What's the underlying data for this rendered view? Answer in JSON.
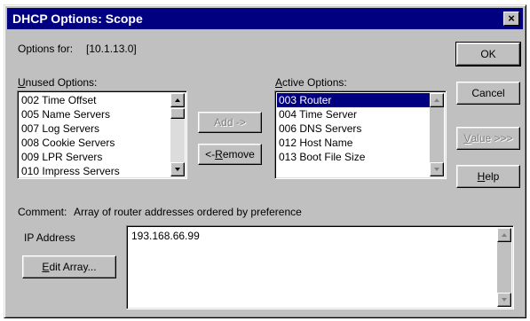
{
  "window": {
    "title": "DHCP Options: Scope",
    "close_glyph": "×"
  },
  "options_for": {
    "label": "Options for:",
    "value": "[10.1.13.0]"
  },
  "unused": {
    "label_key": "U",
    "label_rest": "nused Options:",
    "items": [
      "002 Time Offset",
      "005 Name Servers",
      "007 Log Servers",
      "008 Cookie Servers",
      "009 LPR Servers",
      "010 Impress Servers"
    ]
  },
  "active": {
    "label_key": "A",
    "label_rest": "ctive Options:",
    "items": [
      "003 Router",
      "004 Time Server",
      "006 DNS Servers",
      "012 Host Name",
      "013 Boot File Size"
    ],
    "selected_index": 0
  },
  "buttons": {
    "add": "Add ->",
    "remove_prefix": "<- ",
    "remove_key": "R",
    "remove_rest": "emove",
    "ok": "OK",
    "cancel": "Cancel",
    "value_key": "V",
    "value_rest": "alue >>>",
    "help_key": "H",
    "help_rest": "elp",
    "edit_key": "E",
    "edit_rest": "dit Array..."
  },
  "comment": {
    "label": "Comment:",
    "text": "Array of router addresses ordered by preference"
  },
  "ip": {
    "label": "IP Address",
    "value": "193.168.66.99"
  }
}
